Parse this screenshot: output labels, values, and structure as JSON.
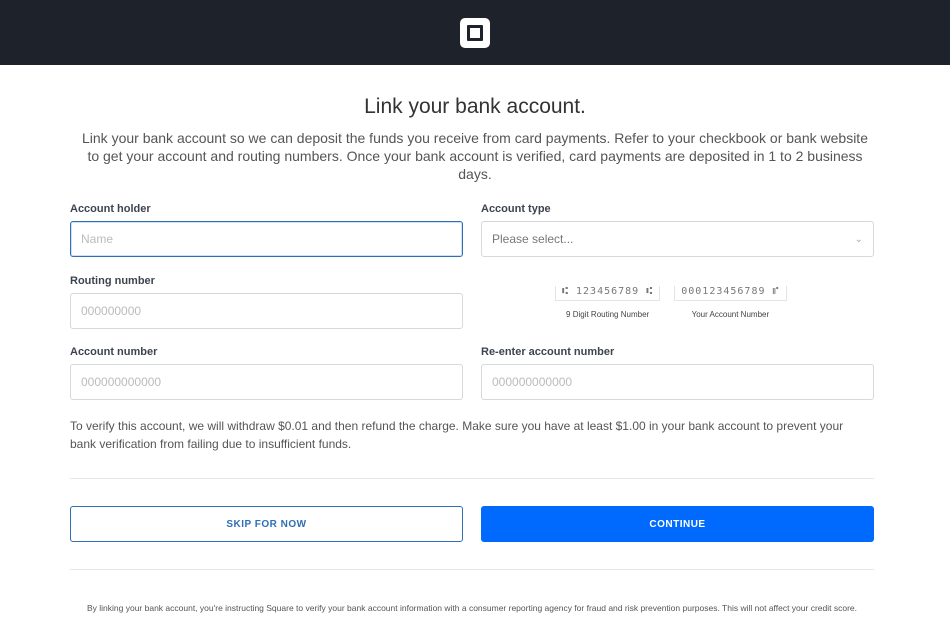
{
  "header": {
    "logo": "Square"
  },
  "title": "Link your bank account.",
  "intro": "Link your bank account so we can deposit the funds you receive from card payments. Refer to your checkbook or bank website to get your account and routing numbers. Once your bank account is verified, card payments are deposited in 1 to 2 business days.",
  "fields": {
    "account_holder": {
      "label": "Account holder",
      "placeholder": "Name"
    },
    "account_type": {
      "label": "Account type",
      "value": "Please select..."
    },
    "routing_number": {
      "label": "Routing number",
      "placeholder": "000000000"
    },
    "account_number": {
      "label": "Account number",
      "placeholder": "000000000000"
    },
    "reenter_account_number": {
      "label": "Re-enter account number",
      "placeholder": "000000000000"
    }
  },
  "check": {
    "routing_digits": "⑆ 123456789 ⑆",
    "routing_caption": "9 Digit Routing Number",
    "account_digits": "000123456789 ⑈",
    "account_caption": "Your Account Number"
  },
  "note": "To verify this account, we will withdraw $0.01 and then refund the charge. Make sure you have at least $1.00 in your bank account to prevent your bank verification from failing due to insufficient funds.",
  "buttons": {
    "skip": "SKIP FOR NOW",
    "continue": "CONTINUE"
  },
  "legal": "By linking your bank account, you're instructing Square to verify your bank account information with a consumer reporting agency for fraud and risk prevention purposes. This will not affect your credit score.",
  "colors": {
    "header": "#1d222b",
    "primary": "#006aff",
    "outline": "#2f6fb6"
  }
}
